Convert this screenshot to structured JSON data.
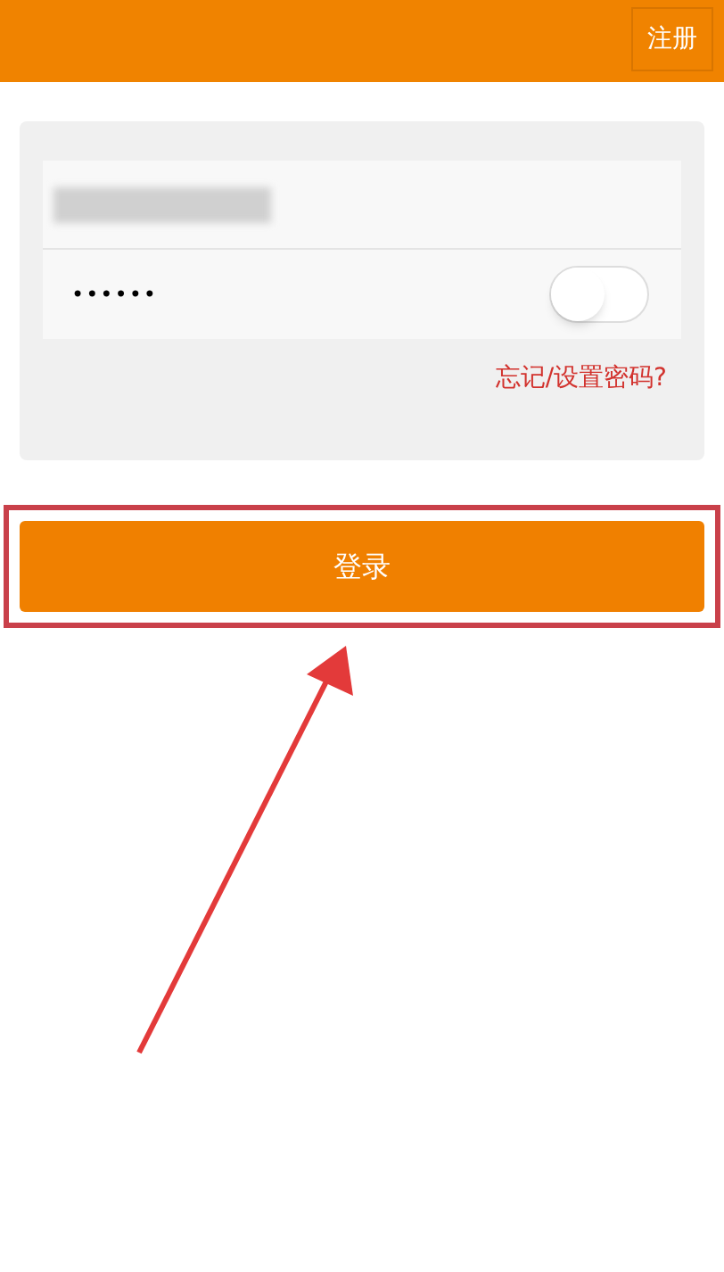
{
  "header": {
    "register_button": "注册"
  },
  "login_form": {
    "password": {
      "value": "••••••"
    },
    "show_password_toggle": {
      "on": false
    },
    "forgot_link": "忘记/设置密码?"
  },
  "login_button": "登录"
}
